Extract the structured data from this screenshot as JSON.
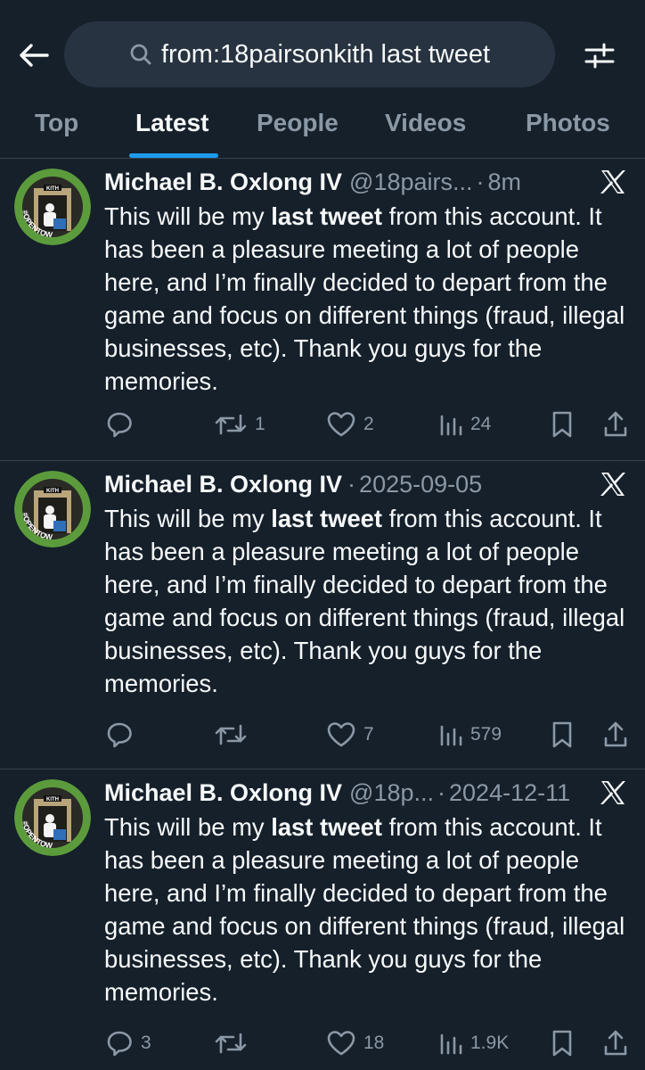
{
  "search": {
    "query": "from:18pairsonkith last tweet"
  },
  "tabs": [
    {
      "label": "Top"
    },
    {
      "label": "Latest"
    },
    {
      "label": "People"
    },
    {
      "label": "Videos"
    },
    {
      "label": "Photos"
    }
  ],
  "colors": {
    "background": "#15202b",
    "accent": "#1d9bf0",
    "muted": "#8b98a5",
    "divider": "#38444d",
    "avatar_ring": "#5b9b3c"
  },
  "avatar": {
    "sign_text": "KITH",
    "badge_text": "#OPENTOWORK"
  },
  "tweets": [
    {
      "name": "Michael B. Oxlong IV",
      "handle": "@18pairs...",
      "dot": "·",
      "time": "8m",
      "text_pre": "This will be my ",
      "text_bold": "last tweet",
      "text_post": " from this account. It has been a pleasure meeting a lot of people here, and I’m finally decided to depart from the game and focus on different things (fraud, illegal businesses, etc). Thank you guys for the memories.",
      "replies": "",
      "retweets": "1",
      "likes": "2",
      "views": "24"
    },
    {
      "name": "Michael B. Oxlong IV",
      "handle": "",
      "dot": "·",
      "time": "2025-09-05",
      "text_pre": "This will be my ",
      "text_bold": "last tweet",
      "text_post": " from this account. It has been a pleasure meeting a lot of people here, and I’m finally decided to depart from the game and focus on different things (fraud, illegal businesses, etc). Thank you guys for the memories.",
      "replies": "",
      "retweets": "",
      "likes": "7",
      "views": "579"
    },
    {
      "name": "Michael B. Oxlong IV",
      "handle": "@18p...",
      "dot": "·",
      "time": "2024-12-11",
      "text_pre": "This will be my ",
      "text_bold": "last tweet",
      "text_post": " from this account. It has been a pleasure meeting a lot of people here, and I’m finally decided to depart from the game and focus on different things (fraud, illegal businesses, etc). Thank you guys for the memories.",
      "replies": "3",
      "retweets": "",
      "likes": "18",
      "views": "1.9K"
    }
  ],
  "icons": {
    "back": "arrow-left-icon",
    "search": "search-icon",
    "filter": "sliders-icon",
    "x": "x-logo-icon",
    "reply": "reply-icon",
    "retweet": "retweet-icon",
    "like": "heart-icon",
    "views": "views-icon",
    "bookmark": "bookmark-icon",
    "share": "share-icon"
  }
}
